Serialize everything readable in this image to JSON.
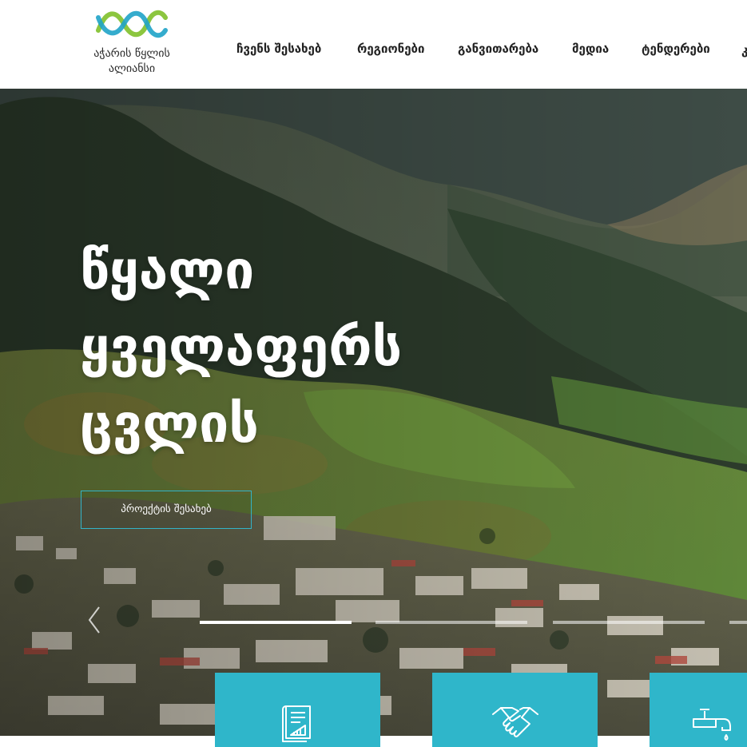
{
  "logo": {
    "line1": "აჭარის წყლის",
    "line2": "ალიანსი"
  },
  "nav": {
    "items": [
      {
        "label": "ჩვენს შესახებ"
      },
      {
        "label": "რეგიონები"
      },
      {
        "label": "განვითარება"
      },
      {
        "label": "მედია"
      },
      {
        "label": "ტენდერები"
      }
    ],
    "edge_glyph": "კ"
  },
  "hero": {
    "title_lines": [
      "წყალი",
      "ყველაფერს",
      "ცვლის"
    ],
    "button_label": "პროექტის შესახებ",
    "slider": {
      "active_index": 0,
      "slide_count": 4
    }
  },
  "cards": [
    {
      "icon": "blueprint-icon"
    },
    {
      "icon": "handshake-icon"
    },
    {
      "icon": "water-tap-icon"
    }
  ],
  "colors": {
    "accent": "#2fb6ca",
    "logo_green": "#8cc63f",
    "logo_blue": "#1fa3c8"
  }
}
